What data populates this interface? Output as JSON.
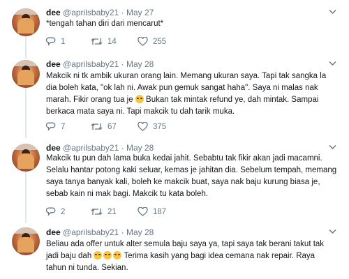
{
  "tweets": [
    {
      "name": "dee",
      "handle": "@aprilsbaby21",
      "dot": "·",
      "date": "May 27",
      "lines": [
        "*tengah tahan diri dari mencarut*"
      ],
      "replies": "1",
      "retweets": "14",
      "likes": "255"
    },
    {
      "name": "dee",
      "handle": "@aprilsbaby21",
      "dot": "·",
      "date": "May 28",
      "lines": [
        "Makcik ni tk ambik ukuran orang lain. Memang ukuran saya. Tapi tak sangka la",
        "dia boleh kata, \"ok lah ni. Awak pun gemuk sangat haha\". Saya ni malas nak",
        "marah. Fikir orang tua je",
        "Bukan tak mintak refund ye, dah mintak. Sampai",
        "berkaca mata saya ni. Tapi makcik tu dah tarik muka."
      ],
      "replies": "7",
      "retweets": "67",
      "likes": "375"
    },
    {
      "name": "dee",
      "handle": "@aprilsbaby21",
      "dot": "·",
      "date": "May 28",
      "lines": [
        "Makcik tu pun dah lama buka kedai jahit. Sebabtu tak fikir akan jadi macamni.",
        "Selalu hantar potong kaki seluar, kemas je jahitan dia. Sebelum tempah, memang",
        "saya tanya banyak kali, boleh ke makcik buat, saya nak baju kurung biasa je,",
        "sebab kain ni mak bagi. Makcik tu kata boleh."
      ],
      "replies": "2",
      "retweets": "21",
      "likes": "187"
    },
    {
      "name": "dee",
      "handle": "@aprilsbaby21",
      "dot": "·",
      "date": "May 28",
      "lines": [
        "Beliau ada offer untuk alter semula baju saya ya, tapi saya tak berani takut tak",
        "jadi baju dah",
        "Terima kasih yang bagi idea cemana nak repair. Raya",
        "tahun ni tunda. Sekian."
      ]
    }
  ],
  "icons": {
    "reply": "reply-icon",
    "retweet": "retweet-icon",
    "like": "heart-icon",
    "more": "chevron-down-icon",
    "emoji": "grinning-sweat-emoji-icon"
  },
  "colors": {
    "text": "#14171a",
    "muted": "#657786",
    "thread_line": "#e1e8ed"
  }
}
